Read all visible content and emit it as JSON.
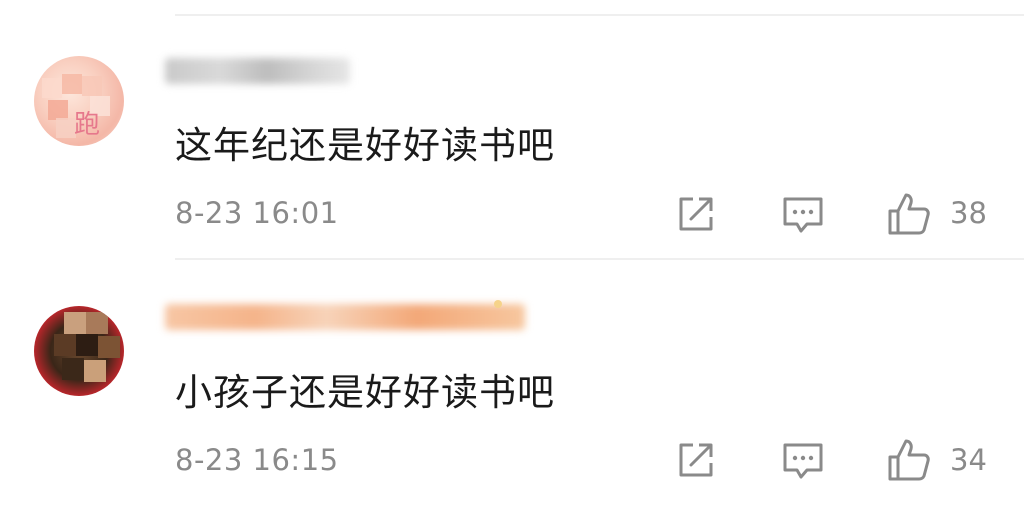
{
  "comments": [
    {
      "text": "这年纪还是好好读书吧",
      "timestamp": "8-23 16:01",
      "likes": "38",
      "avatar_glyph": "跑"
    },
    {
      "text": "小孩子还是好好读书吧",
      "timestamp": "8-23 16:15",
      "likes": "34"
    }
  ],
  "icons": {
    "share": "share-icon",
    "reply": "comment-icon",
    "like": "thumbs-up-icon"
  },
  "colors": {
    "text": "#1a1a1a",
    "secondary": "#8a8a8a",
    "divider": "#efefef"
  }
}
